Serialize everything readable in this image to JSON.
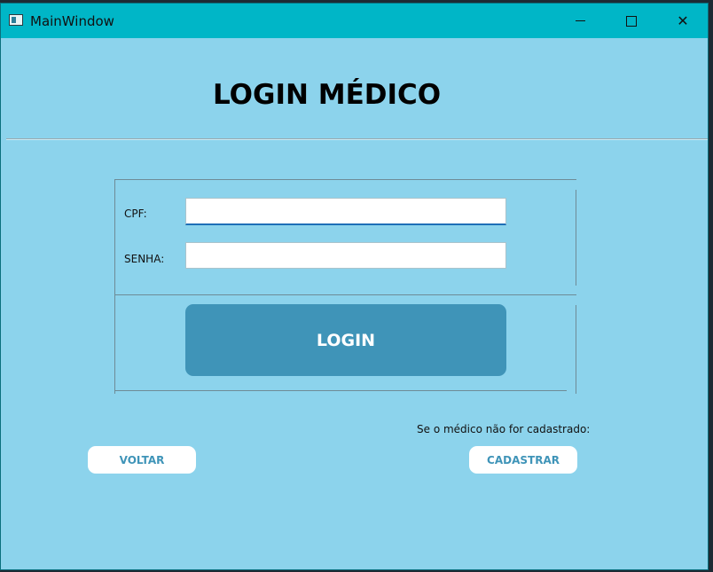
{
  "window": {
    "title": "MainWindow",
    "icons": [
      "app-icon",
      "minimize-icon",
      "maximize-icon",
      "close-icon"
    ],
    "close_glyph": "✕"
  },
  "page": {
    "heading": "LOGIN MÉDICO"
  },
  "form": {
    "cpf_label": "CPF:",
    "cpf_value": "",
    "senha_label": "SENHA:",
    "senha_value": "",
    "login_button": "LOGIN"
  },
  "footer": {
    "note": "Se o médico não for cadastrado:",
    "voltar_button": "VOLTAR",
    "cadastrar_button": "CADASTRAR"
  },
  "colors": {
    "titlebar": "#00b6c7",
    "background": "#8cd3ec",
    "accent": "#3f94b8"
  }
}
